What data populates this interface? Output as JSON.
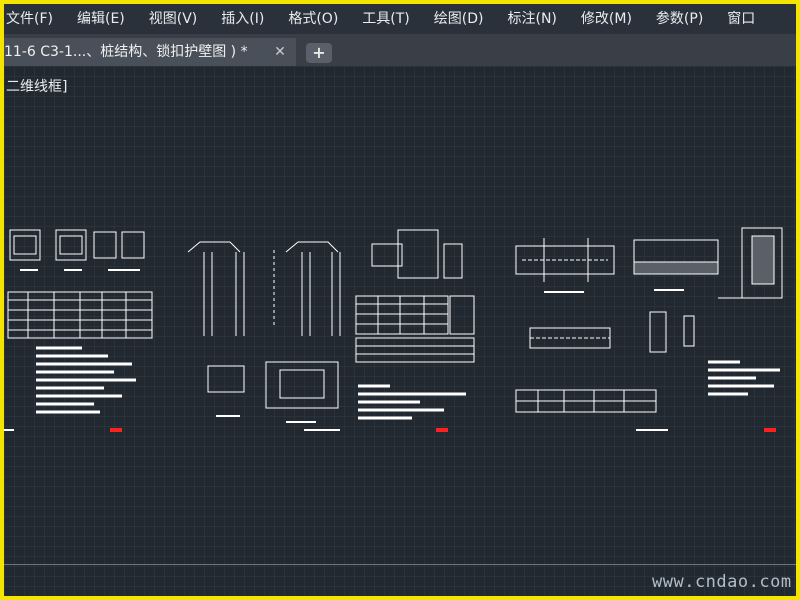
{
  "menu": {
    "items": [
      "文件(F)",
      "编辑(E)",
      "视图(V)",
      "插入(I)",
      "格式(O)",
      "工具(T)",
      "绘图(D)",
      "标注(N)",
      "修改(M)",
      "参数(P)",
      "窗口"
    ]
  },
  "tabs": {
    "active_title": "11-6  C3-1...、桩结构、锁扣护壁图 ) *",
    "close_glyph": "✕",
    "new_glyph": "+"
  },
  "viewport": {
    "label": "二维线框]"
  },
  "watermark": {
    "text": "www.cndao.com"
  },
  "colors": {
    "background": "#212830",
    "linework": "#ffffff",
    "markers": "#ff2020",
    "frame": "#f5e400"
  }
}
